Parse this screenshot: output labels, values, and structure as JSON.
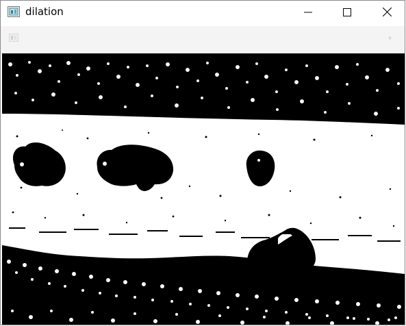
{
  "window": {
    "title": "dilation",
    "controls": {
      "minimize": "minimize",
      "maximize": "maximize",
      "close": "close"
    }
  },
  "toolbar": {
    "label": "",
    "icon": "toolbar-image-icon",
    "dropdown_icon": "chevron-down-icon"
  },
  "image": {
    "kind": "binary morphological dilation result",
    "colors": {
      "foreground": "#ffffff",
      "background": "#000000"
    }
  }
}
